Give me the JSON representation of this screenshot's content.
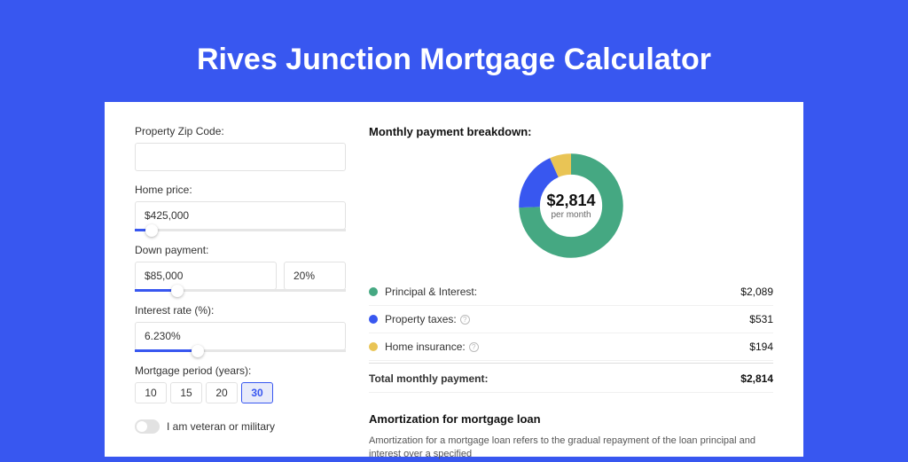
{
  "page_title": "Rives Junction Mortgage Calculator",
  "form": {
    "zip_label": "Property Zip Code:",
    "zip_value": "",
    "home_price_label": "Home price:",
    "home_price_value": "$425,000",
    "down_payment_label": "Down payment:",
    "down_payment_value": "$85,000",
    "down_payment_pct": "20%",
    "interest_label": "Interest rate (%):",
    "interest_value": "6.230%",
    "period_label": "Mortgage period (years):",
    "periods": [
      "10",
      "15",
      "20",
      "30"
    ],
    "period_active_index": 3,
    "veteran_label": "I am veteran or military"
  },
  "breakdown": {
    "title": "Monthly payment breakdown:",
    "center_amount": "$2,814",
    "center_label": "per month",
    "rows": [
      {
        "label": "Principal & Interest:",
        "value": "$2,089",
        "color": "#45a882",
        "has_info": false
      },
      {
        "label": "Property taxes:",
        "value": "$531",
        "color": "#3857f0",
        "has_info": true
      },
      {
        "label": "Home insurance:",
        "value": "$194",
        "color": "#e9c455",
        "has_info": true
      }
    ],
    "total_label": "Total monthly payment:",
    "total_value": "$2,814"
  },
  "amortization": {
    "title": "Amortization for mortgage loan",
    "text": "Amortization for a mortgage loan refers to the gradual repayment of the loan principal and interest over a specified"
  },
  "chart_data": {
    "type": "pie",
    "title": "Monthly payment breakdown",
    "series": [
      {
        "name": "Principal & Interest",
        "value": 2089,
        "color": "#45a882"
      },
      {
        "name": "Property taxes",
        "value": 531,
        "color": "#3857f0"
      },
      {
        "name": "Home insurance",
        "value": 194,
        "color": "#e9c455"
      }
    ],
    "total": 2814,
    "center_label": "per month",
    "donut": true
  },
  "sliders": {
    "home_price_pct": 8,
    "down_payment_pct": 20,
    "interest_pct": 30
  }
}
